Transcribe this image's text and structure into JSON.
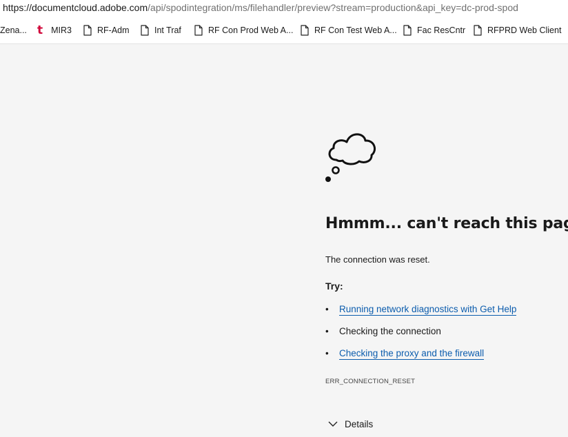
{
  "address_bar": {
    "url_host": "https://documentcloud.adobe.com",
    "url_path": "/api/spodintegration/ms/filehandler/preview?stream=production&api_key=dc-prod-spod"
  },
  "bookmarks": [
    {
      "label": "Zena...",
      "icon": "none"
    },
    {
      "label": "MIR3",
      "icon": "t-logo-icon"
    },
    {
      "label": "RF-Adm",
      "icon": "page-icon"
    },
    {
      "label": "Int Traf",
      "icon": "page-icon"
    },
    {
      "label": "RF Con Prod Web A...",
      "icon": "page-icon"
    },
    {
      "label": "RF Con Test Web A...",
      "icon": "page-icon"
    },
    {
      "label": "Fac ResCntr",
      "icon": "page-icon"
    },
    {
      "label": "RFPRD Web Client",
      "icon": "page-icon"
    }
  ],
  "error": {
    "icon": "thought-cloud-icon",
    "title": "Hmmm... can't reach this page",
    "reason": "The connection was reset.",
    "try_label": "Try:",
    "suggestions": [
      {
        "text": "Running network diagnostics with Get Help",
        "is_link": true
      },
      {
        "text": "Checking the connection",
        "is_link": false
      },
      {
        "text": "Checking the proxy and the firewall",
        "is_link": true
      }
    ],
    "bullet": "•",
    "code": "ERR_CONNECTION_RESET",
    "details_label": "Details"
  },
  "colors": {
    "background": "#f5f5f5",
    "link": "#0b5cad",
    "mir3_logo": "#d10a3c"
  }
}
